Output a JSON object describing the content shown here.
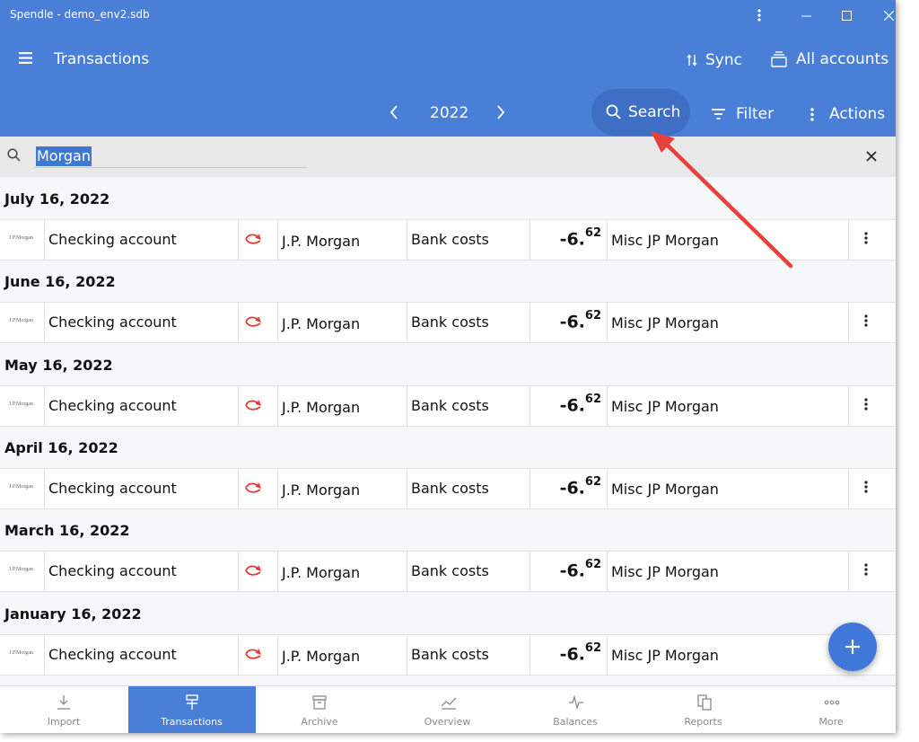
{
  "window": {
    "title": "Spendle - demo_env2.sdb",
    "accent": "#4a7fd8"
  },
  "header": {
    "page_title": "Transactions",
    "sync_label": "Sync",
    "accounts_label": "All accounts",
    "year": "2022",
    "search_label": "Search",
    "filter_label": "Filter",
    "actions_label": "Actions"
  },
  "search": {
    "value": "Morgan"
  },
  "groups": [
    {
      "date": "July 16, 2022"
    },
    {
      "date": "June 16, 2022"
    },
    {
      "date": "May 16, 2022"
    },
    {
      "date": "April 16, 2022"
    },
    {
      "date": "March 16, 2022"
    },
    {
      "date": "January 16, 2022"
    }
  ],
  "transaction": {
    "logo_text": "J.P.Morgan",
    "account": "Checking account",
    "payee": "J.P. Morgan",
    "category": "Bank costs",
    "amount_int": "-6.",
    "amount_dec": "62",
    "description": "Misc JP Morgan",
    "transfer_icon_color": "#e53935"
  },
  "bottom_nav": [
    {
      "label": "Import",
      "icon": "import-icon"
    },
    {
      "label": "Transactions",
      "icon": "transactions-icon",
      "active": true
    },
    {
      "label": "Archive",
      "icon": "archive-icon"
    },
    {
      "label": "Overview",
      "icon": "overview-icon"
    },
    {
      "label": "Balances",
      "icon": "balances-icon"
    },
    {
      "label": "Reports",
      "icon": "reports-icon"
    },
    {
      "label": "More",
      "icon": "more-icon"
    }
  ],
  "annotation_color": "#e8413d"
}
